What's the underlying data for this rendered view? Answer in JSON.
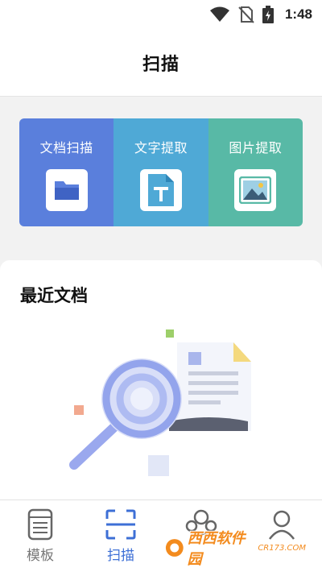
{
  "status_bar": {
    "time": "1:48",
    "icons": [
      "wifi-icon",
      "no-sim-icon",
      "battery-charging-icon"
    ]
  },
  "header": {
    "title": "扫描"
  },
  "tools": [
    {
      "label": "文档扫描",
      "icon": "folder-icon",
      "color": "#5a7fdc"
    },
    {
      "label": "文字提取",
      "icon": "text-file-icon",
      "color": "#4fa9d6"
    },
    {
      "label": "图片提取",
      "icon": "image-icon",
      "color": "#58b9a6"
    }
  ],
  "recent": {
    "title": "最近文档",
    "illustration": "empty-documents-illustration"
  },
  "tabbar": {
    "active": "扫描",
    "accent": "#3d6fd6",
    "tabs": [
      {
        "label": "模板",
        "icon": "template-icon"
      },
      {
        "label": "扫描",
        "icon": "scan-icon"
      },
      {
        "label": "",
        "icon": "group-icon"
      },
      {
        "label": "",
        "icon": "profile-icon"
      }
    ]
  },
  "watermark": {
    "text": "西西软件园",
    "url": "CR173.COM"
  }
}
